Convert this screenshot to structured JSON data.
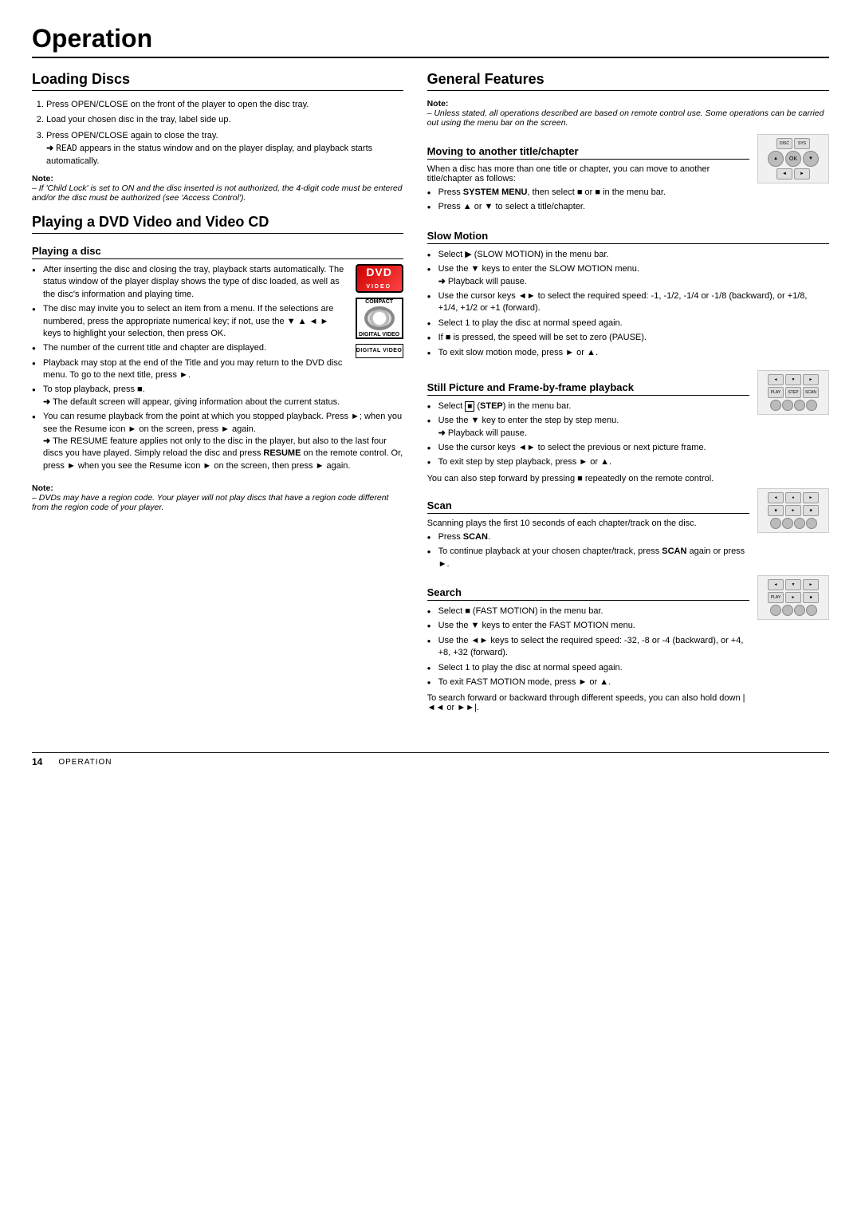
{
  "page": {
    "title": "Operation",
    "footer_number": "14",
    "footer_label": "Operation"
  },
  "left_column": {
    "loading_discs": {
      "title": "Loading Discs",
      "steps": [
        "Press OPEN/CLOSE on the front of the player to open the disc tray.",
        "Load your chosen disc in the tray, label side up.",
        "Press OPEN/CLOSE again to close the tray."
      ],
      "step3_detail": "➜ READ appears in the status window and on the player display, and playback starts automatically.",
      "note_label": "Note:",
      "note_text": "– If 'Child Lock' is set to ON and the disc inserted is not authorized, the 4-digit code must be entered and/or the disc must be authorized (see 'Access Control')."
    },
    "playing_dvd": {
      "title": "Playing a DVD Video and Video CD",
      "playing_a_disc": {
        "subtitle": "Playing a disc",
        "bullets": [
          "After inserting the disc and closing the tray, playback starts automatically. The status window of the player display shows the type of disc loaded, as well as the disc's information and playing time.",
          "The disc may invite you to select an item from a menu. If the selections are numbered, press the appropriate numerical key; if not, use the ▼ ▲ ◄ ► keys to highlight your selection, then press OK.",
          "The number of the current title and chapter are displayed.",
          "Playback may stop at the end of the Title and you may return to the DVD disc menu. To go to the next title, press ►.",
          "To stop playback, press ■.\n➜ The default screen will appear, giving information about the current status.",
          "You can resume playback from the point at which you stopped playback. Press ►; when you see the Resume icon ► on the screen, press ► again.\n➜ The RESUME feature applies not only to the disc in the player, but also to the last four discs you have played. Simply reload the disc and press RESUME on the remote control. Or, press ► when you see the Resume icon ► on the screen, then press ► again."
        ],
        "note_label": "Note:",
        "note_text": "– DVDs may have a region code. Your player will not play discs that have a region code different from the region code of your player."
      }
    }
  },
  "right_column": {
    "general_features": {
      "title": "General Features",
      "note_label": "Note:",
      "note_text": "– Unless stated, all operations described are based on remote control use. Some operations can be carried out using the menu bar on the screen.",
      "moving_title": {
        "subtitle": "Moving to another title/chapter",
        "intro": "When a disc has more than one title or chapter, you can move to another title/chapter as follows:",
        "bullets": [
          "Press SYSTEM MENU, then select ■ or ■ in the menu bar.",
          "Press ▲ or ▼ to select a title/chapter."
        ]
      },
      "slow_motion": {
        "subtitle": "Slow Motion",
        "bullets": [
          "Select ▶ (SLOW MOTION) in the menu bar.",
          "Use the ▼ keys to enter the SLOW MOTION menu.\n➜ Playback will pause.",
          "Use the cursor keys ◄► to select the required speed: -1, -1/2, -1/4 or -1/8 (backward), or +1/8, +1/4, +1/2 or +1 (forward).",
          "Select 1 to play the disc at normal speed again.",
          "If ■ is pressed, the speed will be set to zero (PAUSE).",
          "To exit slow motion mode, press ► or ▲."
        ]
      },
      "still_picture": {
        "subtitle": "Still Picture and Frame-by-frame playback",
        "bullets": [
          "Select ■ (STEP) in the menu bar.",
          "Use the ▼ key to enter the step by step menu.\n➜ Playback will pause.",
          "Use the cursor keys ◄► to select the previous or next picture frame.",
          "To exit step by step playback, press ► or ▲."
        ],
        "extra": "You can also step forward by pressing ■ repeatedly on the remote control."
      },
      "scan": {
        "subtitle": "Scan",
        "intro": "Scanning plays the first 10 seconds of each chapter/track on the disc.",
        "bullets": [
          "Press SCAN.",
          "To continue playback at your chosen chapter/track, press SCAN again or press ►."
        ]
      },
      "search": {
        "subtitle": "Search",
        "bullets": [
          "Select ■ (FAST MOTION) in the menu bar.",
          "Use the ▼ keys to enter the FAST MOTION menu.",
          "Use the ◄► keys to select the required speed: -32, -8 or -4 (backward), or +4, +8, +32 (forward).",
          "Select 1 to play the disc at normal speed again.",
          "To exit FAST MOTION mode, press ► or ▲."
        ],
        "extra": "To search forward or backward through different speeds, you can also hold down |◄◄ or ►►|."
      }
    }
  }
}
